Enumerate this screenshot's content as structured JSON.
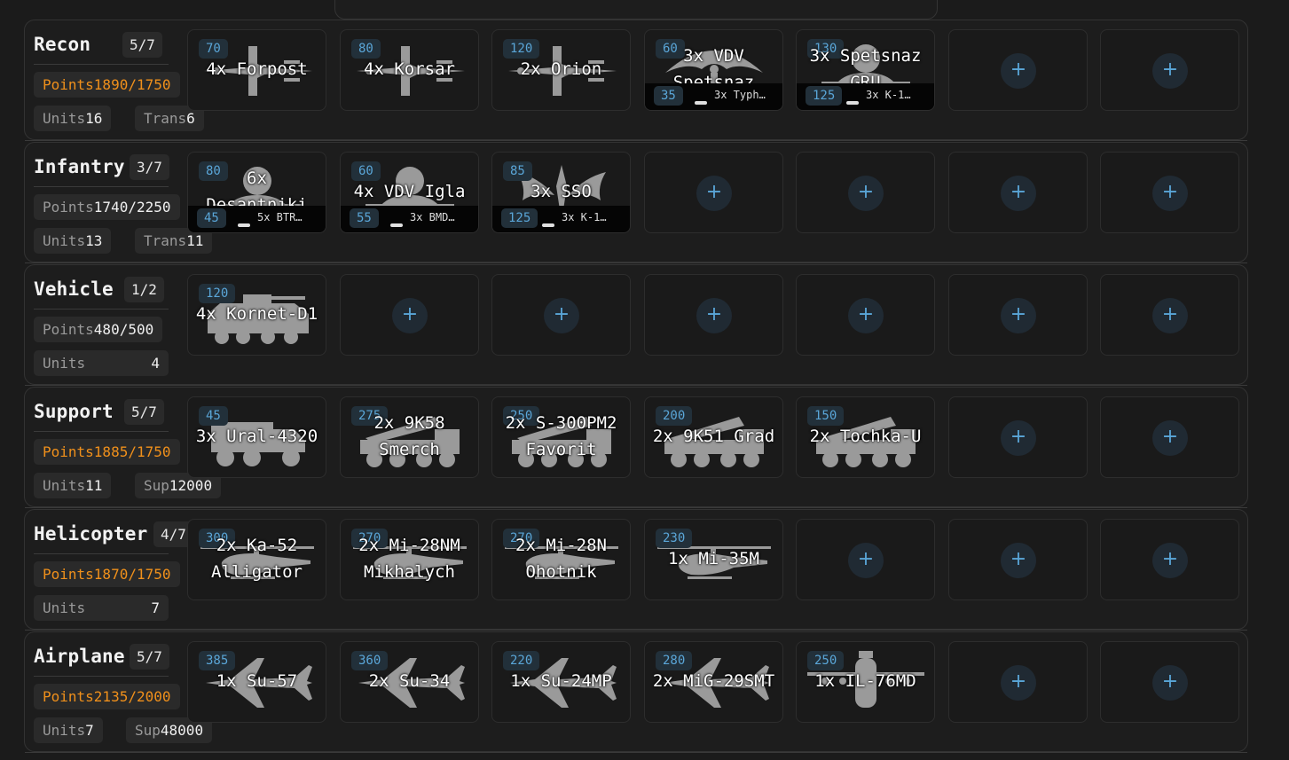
{
  "colors": {
    "accent": "#5aa6d8",
    "warning": "#f0901b",
    "background": "#1b1b1b"
  },
  "add_label": "+",
  "categories": [
    {
      "title": "Recon",
      "count": "5/7",
      "points_label": "Points",
      "points": "1890/1750",
      "points_over": true,
      "units_label": "Units",
      "units": "16",
      "extra_label": "Trans",
      "extra": "6",
      "slots": [
        {
          "cost": "70",
          "name": "4x Forpost",
          "icon": "drone-icon"
        },
        {
          "cost": "80",
          "name": "4x Korsar",
          "icon": "drone-icon"
        },
        {
          "cost": "120",
          "name": "2x Orion",
          "icon": "drone-icon"
        },
        {
          "cost": "60",
          "name": "3x VDV Spetsnaz",
          "icon": "paratrooper-icon",
          "transport": {
            "cost": "35",
            "name": "3x Typh…",
            "icon": "truck-icon"
          }
        },
        {
          "cost": "130",
          "name": "3x Spetsnaz GRU",
          "icon": "infantry-icon",
          "transport": {
            "cost": "125",
            "name": "3x K-1…",
            "icon": "truck-icon"
          }
        },
        null,
        null
      ]
    },
    {
      "title": "Infantry",
      "count": "3/7",
      "points_label": "Points",
      "points": "1740/2250",
      "points_over": false,
      "units_label": "Units",
      "units": "13",
      "extra_label": "Trans",
      "extra": "11",
      "slots": [
        {
          "cost": "80",
          "name": "6x Desantniki",
          "icon": "infantry-icon",
          "transport": {
            "cost": "45",
            "name": "5x BTR…",
            "icon": "apc-icon"
          }
        },
        {
          "cost": "60",
          "name": "4x VDV Igla",
          "icon": "infantry-icon",
          "transport": {
            "cost": "55",
            "name": "3x BMD…",
            "icon": "apc-icon"
          }
        },
        {
          "cost": "85",
          "name": "3x SSO",
          "icon": "insignia-icon",
          "transport": {
            "cost": "125",
            "name": "3x K-1…",
            "icon": "truck-icon"
          }
        },
        null,
        null,
        null,
        null
      ]
    },
    {
      "title": "Vehicle",
      "count": "1/2",
      "points_label": "Points",
      "points": "480/500",
      "points_over": false,
      "units_label": "Units",
      "units": "4",
      "extra_label": "",
      "extra": "",
      "slots": [
        {
          "cost": "120",
          "name": "4x Kornet-D1",
          "icon": "apc-icon"
        },
        null,
        null,
        null,
        null,
        null,
        null
      ]
    },
    {
      "title": "Support",
      "count": "5/7",
      "points_label": "Points",
      "points": "1885/1750",
      "points_over": true,
      "units_label": "Units",
      "units": "11",
      "extra_label": "Sup",
      "extra": "12000",
      "slots": [
        {
          "cost": "45",
          "name": "3x Ural-4320",
          "icon": "truck-icon"
        },
        {
          "cost": "275",
          "name": "2x 9K58 Smerch",
          "icon": "launcher-icon"
        },
        {
          "cost": "250",
          "name": "2x S-300PM2 Favorit",
          "icon": "launcher-icon"
        },
        {
          "cost": "200",
          "name": "2x 9K51 Grad",
          "icon": "launcher-icon"
        },
        {
          "cost": "150",
          "name": "2x Tochka-U",
          "icon": "launcher-icon"
        },
        null,
        null
      ]
    },
    {
      "title": "Helicopter",
      "count": "4/7",
      "points_label": "Points",
      "points": "1870/1750",
      "points_over": true,
      "units_label": "Units",
      "units": "7",
      "extra_label": "",
      "extra": "",
      "slots": [
        {
          "cost": "300",
          "name": "2x Ka-52 Alligator",
          "icon": "helicopter-icon"
        },
        {
          "cost": "270",
          "name": "2x Mi-28NM Mikhalych",
          "icon": "helicopter-icon"
        },
        {
          "cost": "270",
          "name": "2x Mi-28N Ohotnik",
          "icon": "helicopter-icon"
        },
        {
          "cost": "230",
          "name": "1x Mi-35M",
          "icon": "helicopter-icon"
        },
        null,
        null,
        null
      ]
    },
    {
      "title": "Airplane",
      "count": "5/7",
      "points_label": "Points",
      "points": "2135/2000",
      "points_over": true,
      "units_label": "Units",
      "units": "7",
      "extra_label": "Sup",
      "extra": "48000",
      "slots": [
        {
          "cost": "385",
          "name": "1x Su-57",
          "icon": "jet-icon"
        },
        {
          "cost": "360",
          "name": "2x Su-34",
          "icon": "jet-icon"
        },
        {
          "cost": "220",
          "name": "1x Su-24MP",
          "icon": "jet-icon"
        },
        {
          "cost": "280",
          "name": "2x MiG-29SMT",
          "icon": "jet-icon"
        },
        {
          "cost": "250",
          "name": "1x IL-76MD",
          "icon": "transport-plane-icon"
        },
        null,
        null
      ]
    }
  ]
}
